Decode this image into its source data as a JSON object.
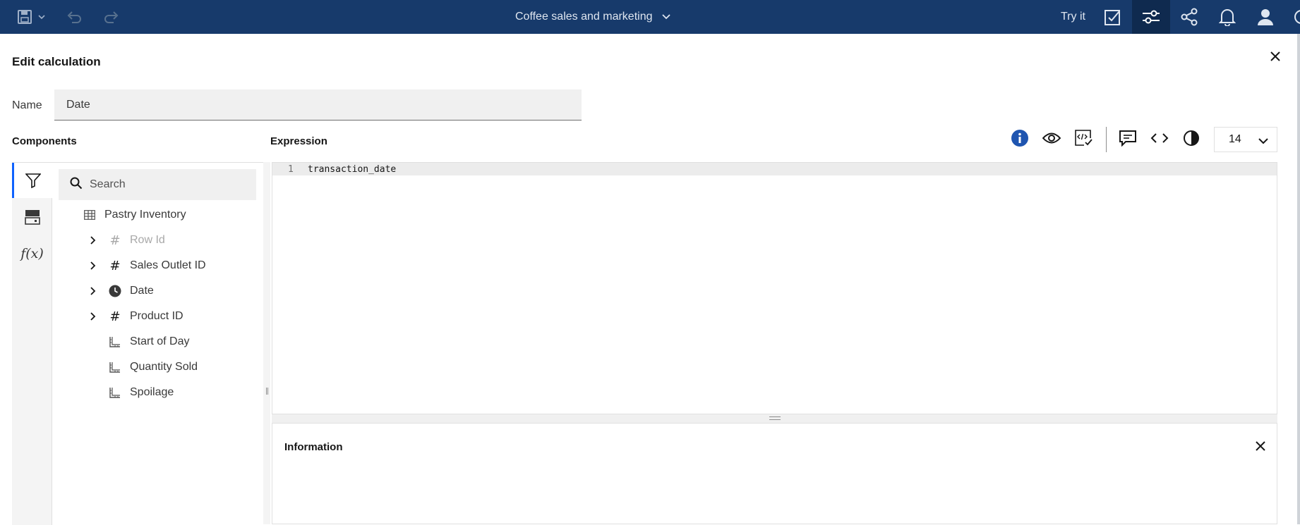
{
  "header": {
    "title": "Coffee sales and marketing",
    "try_it": "Try it",
    "icons": [
      "save-icon",
      "undo-icon",
      "redo-icon",
      "chevron-down-icon",
      "check-icon",
      "sliders-icon",
      "share-icon",
      "bell-icon",
      "user-icon"
    ],
    "bar_color": "#173a6b"
  },
  "dialog": {
    "title": "Edit calculation",
    "name_label": "Name",
    "name_value": "Date",
    "components_label": "Components",
    "expression_label": "Expression",
    "font_size": "14"
  },
  "components": {
    "search_placeholder": "Search",
    "rail": [
      "filter-icon",
      "data-source-icon",
      "function-icon"
    ],
    "function_glyph": "f(x)",
    "table_name": "Pastry Inventory",
    "items": [
      {
        "label": "Row Id",
        "type": "number",
        "expandable": true,
        "disabled": true
      },
      {
        "label": "Sales Outlet ID",
        "type": "number",
        "expandable": true,
        "disabled": false
      },
      {
        "label": "Date",
        "type": "date",
        "expandable": true,
        "disabled": false
      },
      {
        "label": "Product ID",
        "type": "number",
        "expandable": true,
        "disabled": false
      },
      {
        "label": "Start of Day",
        "type": "measure",
        "expandable": false,
        "disabled": false
      },
      {
        "label": "Quantity Sold",
        "type": "measure",
        "expandable": false,
        "disabled": false
      },
      {
        "label": "Spoilage",
        "type": "measure",
        "expandable": false,
        "disabled": false
      }
    ]
  },
  "editor": {
    "line_number": "1",
    "code": "transaction_date"
  },
  "info_panel": {
    "title": "Information"
  },
  "colors": {
    "info_icon": "#0f62fe",
    "active_rail": "#0f62fe"
  }
}
